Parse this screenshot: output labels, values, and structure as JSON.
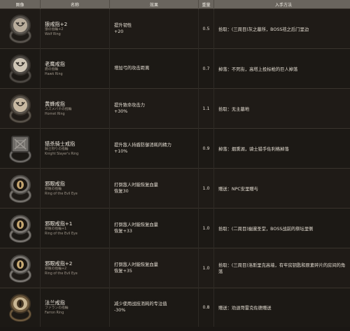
{
  "header": {
    "image": "图像",
    "name": "名称",
    "effect": "效果",
    "weight": "重量",
    "source": "入手方法"
  },
  "rows": [
    {
      "icon": "wolf-ring-icon",
      "name": "狼戒指+2",
      "jp": "狼の指輪+2",
      "en": "Wolf Ring",
      "effect1": "提升韧性",
      "effect2": "+20",
      "weight": "0.5",
      "source": "拾取：(三周目)灰之墓所，BOSS祛之后门里边"
    },
    {
      "icon": "hawk-ring-icon",
      "name": "老鹰戒指",
      "jp": "鷹の指輪",
      "en": "Hawk Ring",
      "effect1": "增加弓的攻击距离",
      "effect2": "",
      "weight": "0.7",
      "source": "掉落：不死街，高塔上投标枪的巨人掉落"
    },
    {
      "icon": "hornet-ring-icon",
      "name": "黄蜂戒指",
      "jp": "スズメバチの指輪",
      "en": "Hornet Ring",
      "effect1": "提升致命攻击力",
      "effect2": "+30%",
      "weight": "1.1",
      "source": "拾取：无主墓地"
    },
    {
      "icon": "knight-slayer-ring-icon",
      "name": "猎杀骑士戒指",
      "jp": "騎士狩りの指輪",
      "en": "Knight Slayer's Ring",
      "effect1": "提升敌人持盾防御消耗的精力",
      "effect2": "+10%",
      "weight": "0.9",
      "source": "掉落：烟熏湖，骑士猎手佐利格掉落"
    },
    {
      "icon": "evil-eye-ring-icon",
      "name": "邪眼戒指",
      "jp": "邪眼の指輪",
      "en": "Ring of the Evil Eye",
      "effect1": "打倒敌人时能恢复血量",
      "effect2": "恢复30",
      "weight": "1.0",
      "source": "赠送：NPC安里赠与"
    },
    {
      "icon": "evil-eye-ring-1-icon",
      "name": "邪眼戒指+1",
      "jp": "邪眼の指輪+1",
      "en": "Ring of the Evil Eye",
      "effect1": "打倒敌人时能恢复血量",
      "effect2": "恢复+33",
      "weight": "1.0",
      "source": "拾取：(二周目)幽邃圣堂，BOSS战前的祭坛里侧"
    },
    {
      "icon": "evil-eye-ring-2-icon",
      "name": "邪眼戒指+2",
      "jp": "邪眼の指輪+2",
      "en": "Ring of the Evil Eye",
      "effect1": "打倒敌人时能恢复血量",
      "effect2": "恢复+35",
      "weight": "1.0",
      "source": "拾取：(三周目)洛斯里克高墙，有牢房钥匙和原素碎片的房间的角落"
    },
    {
      "icon": "farron-ring-icon",
      "name": "法兰戒指",
      "jp": "ファランの指輪",
      "en": "Farron Ring",
      "effect1": "减少使用战技消耗的专注值",
      "effect2": "-30%",
      "weight": "0.8",
      "source": "赠送：劝退哥雷克佐德赠送"
    }
  ]
}
